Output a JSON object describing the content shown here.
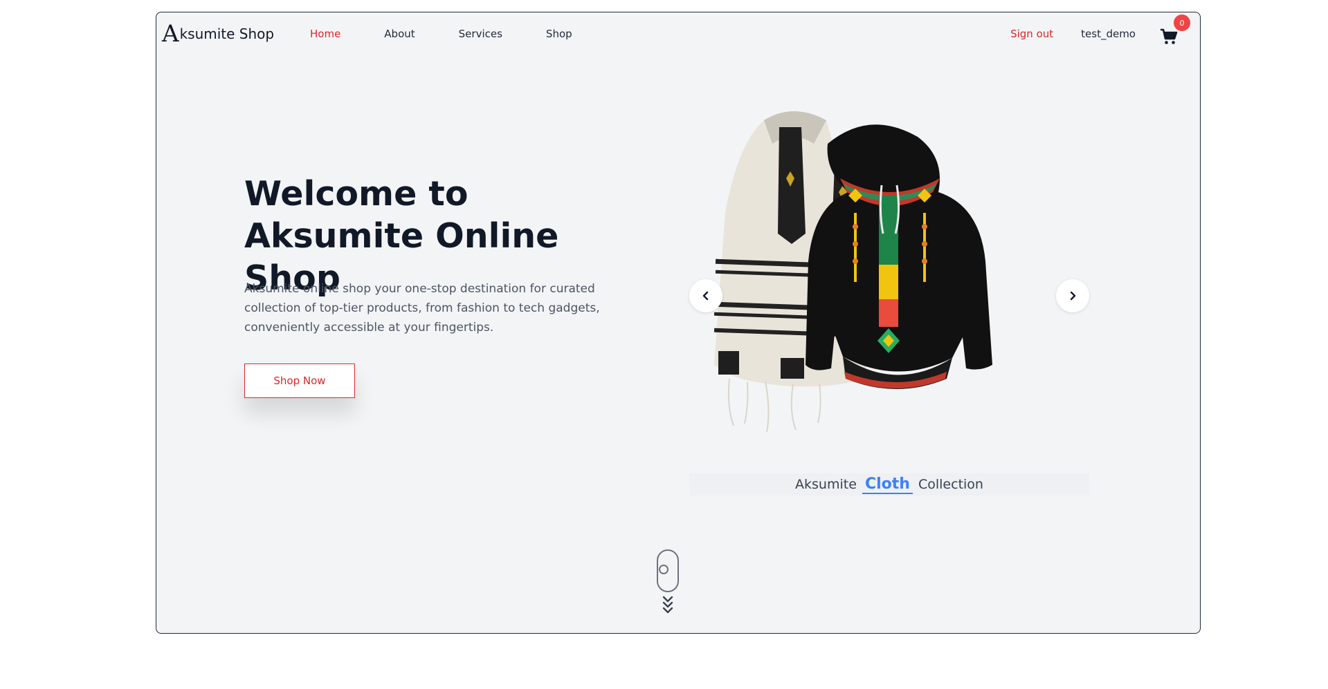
{
  "brand": {
    "logo_letter": "A",
    "name": "ksumite Shop"
  },
  "nav": {
    "links": [
      {
        "label": "Home",
        "active": true
      },
      {
        "label": "About",
        "active": false
      },
      {
        "label": "Services",
        "active": false
      },
      {
        "label": "Shop",
        "active": false
      }
    ],
    "sign_out": "Sign out",
    "username": "test_demo",
    "cart_count": "0"
  },
  "hero": {
    "title": "Welcome to Aksumite Online Shop",
    "description": "Aksumite online shop your one-stop destination for curated collection of top-tier products, from fashion to tech gadgets, conveniently accessible at your fingertips.",
    "cta": "Shop Now"
  },
  "carousel": {
    "caption_prefix": "Aksumite",
    "caption_highlight": "Cloth",
    "caption_suffix": "Collection"
  },
  "colors": {
    "accent_red": "#dc2626",
    "accent_blue": "#3b82f6",
    "background": "#f3f4f6",
    "text_dark": "#111827"
  },
  "icons": [
    "chevron-left-icon",
    "chevron-right-icon",
    "shopping-cart-icon",
    "mouse-scroll-icon",
    "chevron-down-icon"
  ]
}
